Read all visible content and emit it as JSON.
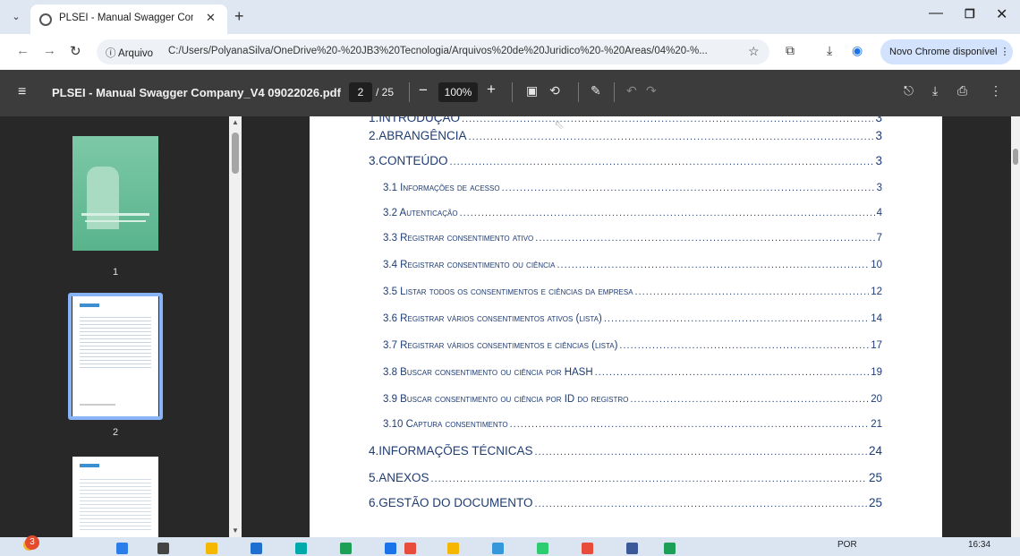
{
  "browser": {
    "tab_title": "PLSEI - Manual Swagger Comp",
    "tab_close": "✕",
    "new_tab": "+",
    "address_info": "ⓘ Arquivo",
    "url": "C:/Users/PolyanaSilva/OneDrive%20-%20JB3%20Tecnologia/Arquivos%20de%20Juridico%20-%20Áreas/04%20-%...",
    "update_button": "Novo Chrome disponível ⋮"
  },
  "pdf_toolbar": {
    "title": "PLSEI - Manual Swagger Company_V4 09022026.pdf",
    "current_page": "2",
    "total_pages": "/ 25",
    "zoom": "100%",
    "zoom_minus": "−",
    "zoom_plus": "+"
  },
  "sidebar": {
    "thumbnails": [
      {
        "label": "1"
      },
      {
        "label": "2"
      }
    ]
  },
  "toc": [
    {
      "label": "1.INTRODUÇÃO",
      "page": "3",
      "level": 1
    },
    {
      "label": "2.ABRANGÊNCIA",
      "page": "3",
      "level": 1
    },
    {
      "label": "3.CONTEÚDO",
      "page": "3",
      "level": 1
    },
    {
      "label": "3.1 Informações de acesso",
      "page": "3",
      "level": 2
    },
    {
      "label": "3.2 Autenticação",
      "page": "4",
      "level": 2
    },
    {
      "label": "3.3 Registrar consentimento ativo",
      "page": "7",
      "level": 2
    },
    {
      "label": "3.4 Registrar consentimento ou ciência",
      "page": "10",
      "level": 2
    },
    {
      "label": "3.5 Listar todos os consentimentos e ciências da empresa",
      "page": "12",
      "level": 2
    },
    {
      "label": "3.6 Registrar vários consentimentos ativos (lista)",
      "page": "14",
      "level": 2
    },
    {
      "label": "3.7 Registrar vários consentimentos e ciências (lista)",
      "page": "17",
      "level": 2
    },
    {
      "label": "3.8 Buscar consentimento ou ciência por HASH",
      "page": "19",
      "level": 2
    },
    {
      "label": "3.9 Buscar consentimento ou ciência por ID do registro",
      "page": "20",
      "level": 2
    },
    {
      "label": "3.10 Captura consentimento",
      "page": "21",
      "level": 2
    },
    {
      "label": "4.INFORMAÇÕES TÉCNICAS",
      "page": "24",
      "level": 1
    },
    {
      "label": "5.ANEXOS",
      "page": "25",
      "level": 1
    },
    {
      "label": "6.GESTÃO DO DOCUMENTO",
      "page": "25",
      "level": 1
    }
  ],
  "taskbar": {
    "notification_count": "3",
    "language": "POR",
    "time": "16:34"
  }
}
